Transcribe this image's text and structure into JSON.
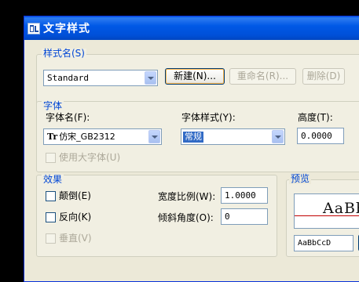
{
  "window": {
    "title": "文字样式"
  },
  "style_name_group": {
    "label": "样式名(S)",
    "selected": "Standard",
    "new_button": "新建(N)...",
    "rename_button": "重命名(R)...",
    "delete_button": "删除(D)"
  },
  "font_group": {
    "label": "字体",
    "font_name_label": "字体名(F):",
    "font_name_value": "仿宋_GB2312",
    "font_style_label": "字体样式(Y):",
    "font_style_value": "常规",
    "height_label": "高度(T):",
    "height_value": "0.0000",
    "bigfont_label": "使用大字体(U)"
  },
  "effects_group": {
    "label": "效果",
    "upside_down": "颠倒(E)",
    "backwards": "反向(K)",
    "vertical": "垂直(V)",
    "width_factor_label": "宽度比例(W):",
    "width_factor_value": "1.0000",
    "oblique_label": "倾斜角度(O):",
    "oblique_value": "0"
  },
  "preview_group": {
    "label": "预览",
    "sample_text": "AaBb",
    "preview_input": "AaBbCcD"
  },
  "colors": {
    "titlebar": "#0058E6",
    "dialog_bg": "#ECE9D8",
    "group_label": "#0046D5",
    "selection": "#316AC5",
    "preview_line": "#C00000"
  }
}
